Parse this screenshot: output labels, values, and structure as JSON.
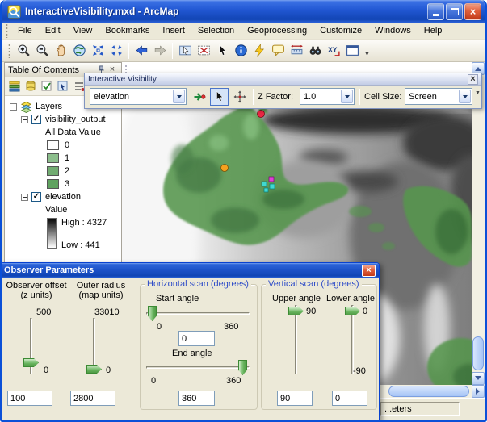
{
  "titlebar": {
    "title": "InteractiveVisibility.mxd - ArcMap"
  },
  "menubar": {
    "items": [
      "File",
      "Edit",
      "View",
      "Bookmarks",
      "Insert",
      "Selection",
      "Geoprocessing",
      "Customize",
      "Windows",
      "Help"
    ]
  },
  "main_toolbar": {
    "icons": [
      "zoom-in",
      "zoom-out",
      "pan",
      "full-extent",
      "fixed-zoom-in",
      "fixed-zoom-out",
      "go-back",
      "go-forward",
      "select-features",
      "clear-selection",
      "select-elements",
      "identify",
      "hyperlink",
      "html-popup",
      "measure",
      "find",
      "go-to-xy",
      "viewer-window"
    ],
    "xy_icon_text": "XY"
  },
  "icons": {
    "check": "✓",
    "close": "×",
    "overflow": "▼"
  },
  "toc": {
    "title": "Table Of Contents",
    "root_label": "Layers",
    "visibility_layer": {
      "name": "visibility_output",
      "value_heading": "All Data Value",
      "classes": [
        {
          "label": "0",
          "color": "#ffffff"
        },
        {
          "label": "1",
          "color": "#8cbe8c"
        },
        {
          "label": "2",
          "color": "#72ac72"
        },
        {
          "label": "3",
          "color": "#5fa25f"
        }
      ]
    },
    "elevation_layer": {
      "name": "elevation",
      "value_heading": "Value",
      "high_label": "High : 4327",
      "low_label": "Low : 441"
    }
  },
  "iv_toolbar": {
    "title": "Interactive Visibility",
    "layer_value": "elevation",
    "z_factor_label": "Z Factor:",
    "z_factor_value": "1.0",
    "cell_size_label": "Cell Size:",
    "cell_size_value": "Screen"
  },
  "dialog": {
    "title": "Observer Parameters",
    "observer_offset": {
      "label1": "Observer offset",
      "label2": "(z units)",
      "max": "500",
      "min": "0",
      "value": "100"
    },
    "outer_radius": {
      "label1": "Outer radius",
      "label2": "(map units)",
      "max": "33010",
      "min": "0",
      "value": "2800"
    },
    "horizontal": {
      "title": "Horizontal scan (degrees)",
      "start_label": "Start angle",
      "start_min": "0",
      "start_max": "360",
      "start_value": "0",
      "end_label": "End angle",
      "end_min": "0",
      "end_max": "360",
      "end_value": "360"
    },
    "vertical": {
      "title": "Vertical scan (degrees)",
      "upper_label": "Upper angle",
      "upper_max": "90",
      "upper_value": "90",
      "lower_label": "Lower angle",
      "lower_max": "0",
      "lower_min": "-90",
      "lower_value": "0"
    }
  },
  "status": {
    "coordinates": "...eters"
  },
  "map": {
    "visible_color": "#56964e",
    "visible_dark_color": "#2e6b2e",
    "visible_light_color": "#7dbd74",
    "markers": [
      {
        "name": "observer-red",
        "color": "#ee2745"
      },
      {
        "name": "observer-orange",
        "color": "#f5a11e"
      },
      {
        "name": "observer-magenta",
        "color": "#e040d8"
      },
      {
        "name": "observer-cyan",
        "color": "#40d8d0"
      }
    ]
  }
}
